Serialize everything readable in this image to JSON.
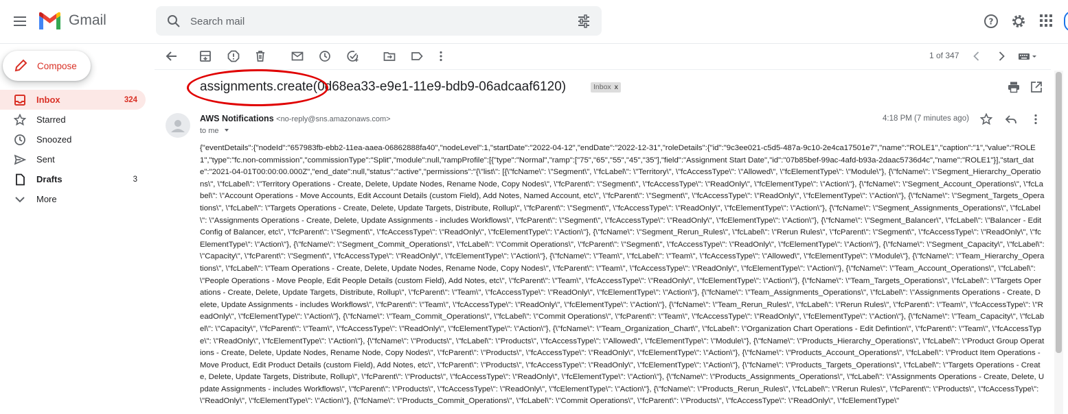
{
  "app": {
    "name": "Gmail"
  },
  "search": {
    "placeholder": "Search mail"
  },
  "sidebar": {
    "compose_label": "Compose",
    "items": [
      {
        "label": "Inbox",
        "count": "324",
        "icon": "inbox-icon",
        "active": true
      },
      {
        "label": "Starred",
        "count": "",
        "icon": "star-icon"
      },
      {
        "label": "Snoozed",
        "count": "",
        "icon": "clock-icon"
      },
      {
        "label": "Sent",
        "count": "",
        "icon": "send-icon"
      },
      {
        "label": "Drafts",
        "count": "3",
        "icon": "draft-icon"
      },
      {
        "label": "More",
        "count": "",
        "icon": "chevron-down-icon"
      }
    ]
  },
  "toolbar": {
    "pager": "1 of 347"
  },
  "email": {
    "subject": "assignments.create(0d68ea33-e9e1-11e9-bdb9-06adcaaf6120)",
    "label_tag": "Inbox",
    "label_tag_close": "x",
    "sender_name": "AWS Notifications",
    "sender_email": "<no-reply@sns.amazonaws.com>",
    "to": "to me",
    "time": "4:18 PM (7 minutes ago)",
    "body": "{\"eventDetails\":{\"nodeId\":\"657983fb-ebb2-11ea-aaea-06862888fa40\",\"nodeLevel\":1,\"startDate\":\"2022-04-12\",\"endDate\":\"2022-12-31\",\"roleDetails\":{\"id\":\"9c3ee021-c5d5-487a-9c10-2e4ca17501e7\",\"name\":\"ROLE1\",\"caption\":\"1\",\"value\":\"ROLE1\",\"type\":\"fc.non-commission\",\"commissionType\":\"Split\",\"module\":null,\"rampProfile\":[{\"type\":\"Normal\",\"ramp\":[\"75\",\"65\",\"55\",\"45\",\"35\"],\"field\":\"Assignment Start Date\",\"id\":\"07b85bef-99ac-4afd-b93a-2daac5736d4c\",\"name\":\"ROLE1\"}],\"start_date\":\"2021-04-01T00:00:00.000Z\",\"end_date\":null,\"status\":\"active\",\"permissions\":\"{\\\"list\\\": [{\\\"fcName\\\": \\\"Segment\\\", \\\"fcLabel\\\": \\\"Territory\\\", \\\"fcAccessType\\\": \\\"Allowed\\\", \\\"fcElementType\\\": \\\"Module\\\"}, {\\\"fcName\\\": \\\"Segment_Hierarchy_Operations\\\", \\\"fcLabel\\\": \\\"Territory Operations - Create, Delete, Update Nodes, Rename Node, Copy Nodes\\\", \\\"fcParent\\\": \\\"Segment\\\", \\\"fcAccessType\\\": \\\"ReadOnly\\\", \\\"fcElementType\\\": \\\"Action\\\"}, {\\\"fcName\\\": \\\"Segment_Account_Operations\\\", \\\"fcLabel\\\": \\\"Account Operations - Move Accounts, Edit Account Details (custom Field), Add Notes, Named Account, etc\\\", \\\"fcParent\\\": \\\"Segment\\\", \\\"fcAccessType\\\": \\\"ReadOnly\\\", \\\"fcElementType\\\": \\\"Action\\\"}, {\\\"fcName\\\": \\\"Segment_Targets_Operations\\\", \\\"fcLabel\\\": \\\"Targets Operations - Create, Delete, Update Targets, Distribute, Rollup\\\", \\\"fcParent\\\": \\\"Segment\\\", \\\"fcAccessType\\\": \\\"ReadOnly\\\", \\\"fcElementType\\\": \\\"Action\\\"}, {\\\"fcName\\\": \\\"Segment_Assignments_Operations\\\", \\\"fcLabel\\\": \\\"Assignments Operations - Create, Delete, Update Assignments - includes Workflows\\\", \\\"fcParent\\\": \\\"Segment\\\", \\\"fcAccessType\\\": \\\"ReadOnly\\\", \\\"fcElementType\\\": \\\"Action\\\"}, {\\\"fcName\\\": \\\"Segment_Balancer\\\", \\\"fcLabel\\\": \\\"Balancer - Edit Config of Balancer, etc\\\", \\\"fcParent\\\": \\\"Segment\\\", \\\"fcAccessType\\\": \\\"ReadOnly\\\", \\\"fcElementType\\\": \\\"Action\\\"}, {\\\"fcName\\\": \\\"Segment_Rerun_Rules\\\", \\\"fcLabel\\\": \\\"Rerun Rules\\\", \\\"fcParent\\\": \\\"Segment\\\", \\\"fcAccessType\\\": \\\"ReadOnly\\\", \\\"fcElementType\\\": \\\"Action\\\"}, {\\\"fcName\\\": \\\"Segment_Commit_Operations\\\", \\\"fcLabel\\\": \\\"Commit Operations\\\", \\\"fcParent\\\": \\\"Segment\\\", \\\"fcAccessType\\\": \\\"ReadOnly\\\", \\\"fcElementType\\\": \\\"Action\\\"}, {\\\"fcName\\\": \\\"Segment_Capacity\\\", \\\"fcLabel\\\": \\\"Capacity\\\", \\\"fcParent\\\": \\\"Segment\\\", \\\"fcAccessType\\\": \\\"ReadOnly\\\", \\\"fcElementType\\\": \\\"Action\\\"}, {\\\"fcName\\\": \\\"Team\\\", \\\"fcLabel\\\": \\\"Team\\\", \\\"fcAccessType\\\": \\\"Allowed\\\", \\\"fcElementType\\\": \\\"Module\\\"}, {\\\"fcName\\\": \\\"Team_Hierarchy_Operations\\\", \\\"fcLabel\\\": \\\"Team Operations - Create, Delete, Update Nodes, Rename Node, Copy Nodes\\\", \\\"fcParent\\\": \\\"Team\\\", \\\"fcAccessType\\\": \\\"ReadOnly\\\", \\\"fcElementType\\\": \\\"Action\\\"}, {\\\"fcName\\\": \\\"Team_Account_Operations\\\", \\\"fcLabel\\\": \\\"People Operations - Move People, Edit People Details (custom Field), Add Notes, etc\\\", \\\"fcParent\\\": \\\"Team\\\", \\\"fcAccessType\\\": \\\"ReadOnly\\\", \\\"fcElementType\\\": \\\"Action\\\"}, {\\\"fcName\\\": \\\"Team_Targets_Operations\\\", \\\"fcLabel\\\": \\\"Targets Operations - Create, Delete, Update Targets, Distribute, Rollup\\\", \\\"fcParent\\\": \\\"Team\\\", \\\"fcAccessType\\\": \\\"ReadOnly\\\", \\\"fcElementType\\\": \\\"Action\\\"}, {\\\"fcName\\\": \\\"Team_Assignments_Operations\\\", \\\"fcLabel\\\": \\\"Assignments Operations - Create, Delete, Update Assignments - includes Workflows\\\", \\\"fcParent\\\": \\\"Team\\\", \\\"fcAccessType\\\": \\\"ReadOnly\\\", \\\"fcElementType\\\": \\\"Action\\\"}, {\\\"fcName\\\": \\\"Team_Rerun_Rules\\\", \\\"fcLabel\\\": \\\"Rerun Rules\\\", \\\"fcParent\\\": \\\"Team\\\", \\\"fcAccessType\\\": \\\"ReadOnly\\\", \\\"fcElementType\\\": \\\"Action\\\"}, {\\\"fcName\\\": \\\"Team_Commit_Operations\\\", \\\"fcLabel\\\": \\\"Commit Operations\\\", \\\"fcParent\\\": \\\"Team\\\", \\\"fcAccessType\\\": \\\"ReadOnly\\\", \\\"fcElementType\\\": \\\"Action\\\"}, {\\\"fcName\\\": \\\"Team_Capacity\\\", \\\"fcLabel\\\": \\\"Capacity\\\", \\\"fcParent\\\": \\\"Team\\\", \\\"fcAccessType\\\": \\\"ReadOnly\\\", \\\"fcElementType\\\": \\\"Action\\\"}, {\\\"fcName\\\": \\\"Team_Organization_Chart\\\", \\\"fcLabel\\\": \\\"Organization Chart Operations - Edit Defintion\\\", \\\"fcParent\\\": \\\"Team\\\", \\\"fcAccessType\\\": \\\"ReadOnly\\\", \\\"fcElementType\\\": \\\"Action\\\"}, {\\\"fcName\\\": \\\"Products\\\", \\\"fcLabel\\\": \\\"Products\\\", \\\"fcAccessType\\\": \\\"Allowed\\\", \\\"fcElementType\\\": \\\"Module\\\"}, {\\\"fcName\\\": \\\"Products_Hierarchy_Operations\\\", \\\"fcLabel\\\": \\\"Product Group Operations - Create, Delete, Update Nodes, Rename Node, Copy Nodes\\\", \\\"fcParent\\\": \\\"Products\\\", \\\"fcAccessType\\\": \\\"ReadOnly\\\", \\\"fcElementType\\\": \\\"Action\\\"}, {\\\"fcName\\\": \\\"Products_Account_Operations\\\", \\\"fcLabel\\\": \\\"Product Item Operations - Move Product, Edit Product Details (custom Field), Add Notes, etc\\\", \\\"fcParent\\\": \\\"Products\\\", \\\"fcAccessType\\\": \\\"ReadOnly\\\", \\\"fcElementType\\\": \\\"Action\\\"}, {\\\"fcName\\\": \\\"Products_Targets_Operations\\\", \\\"fcLabel\\\": \\\"Targets Operations - Create, Delete, Update Targets, Distribute, Rollup\\\", \\\"fcParent\\\": \\\"Products\\\", \\\"fcAccessType\\\": \\\"ReadOnly\\\", \\\"fcElementType\\\": \\\"Action\\\"}, {\\\"fcName\\\": \\\"Products_Assignments_Operations\\\", \\\"fcLabel\\\": \\\"Assignments Operations - Create, Delete, Update Assignments - includes Workflows\\\", \\\"fcParent\\\": \\\"Products\\\", \\\"fcAccessType\\\": \\\"ReadOnly\\\", \\\"fcElementType\\\": \\\"Action\\\"}, {\\\"fcName\\\": \\\"Products_Rerun_Rules\\\", \\\"fcLabel\\\": \\\"Rerun Rules\\\", \\\"fcParent\\\": \\\"Products\\\", \\\"fcAccessType\\\": \\\"ReadOnly\\\", \\\"fcElementType\\\": \\\"Action\\\"}, {\\\"fcName\\\": \\\"Products_Commit_Operations\\\", \\\"fcLabel\\\": \\\"Commit Operations\\\", \\\"fcParent\\\": \\\"Products\\\", \\\"fcAccessType\\\": \\\"ReadOnly\\\", \\\"fcElementType\\\""
  },
  "colors": {
    "accent_red": "#d93025",
    "active_bg": "#fce8e6",
    "annotation_oval": "#e00000",
    "icon_gray": "#5f6368"
  }
}
